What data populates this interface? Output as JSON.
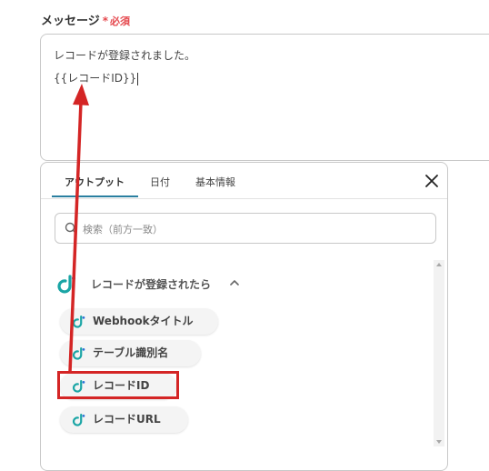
{
  "field": {
    "label": "メッセージ",
    "required_star": "*",
    "required_text": "必須",
    "value_line1": "レコードが登録されました。",
    "value_line2": "{{レコードID}}"
  },
  "dropdown": {
    "tabs": [
      {
        "label": "アウトプット",
        "active": true
      },
      {
        "label": "日付",
        "active": false
      },
      {
        "label": "基本情報",
        "active": false
      }
    ],
    "search_placeholder": "検索（前方一致）",
    "section": {
      "title": "レコードが登録されたら"
    },
    "items": [
      {
        "label": "Webhookタイトル"
      },
      {
        "label": "テーブル識別名"
      },
      {
        "label": "レコードID",
        "highlighted": true
      },
      {
        "label": "レコードURL"
      }
    ]
  },
  "icons": {
    "close": "close-icon",
    "search": "search-icon",
    "app": "app-logo-icon",
    "chevron": "chevron-up-icon"
  },
  "colors": {
    "accent": "#2a7fa0",
    "required": "#e5484d",
    "highlight": "#d42525",
    "logo_teal": "#1aa5a5",
    "logo_blue": "#2d6fd8"
  }
}
